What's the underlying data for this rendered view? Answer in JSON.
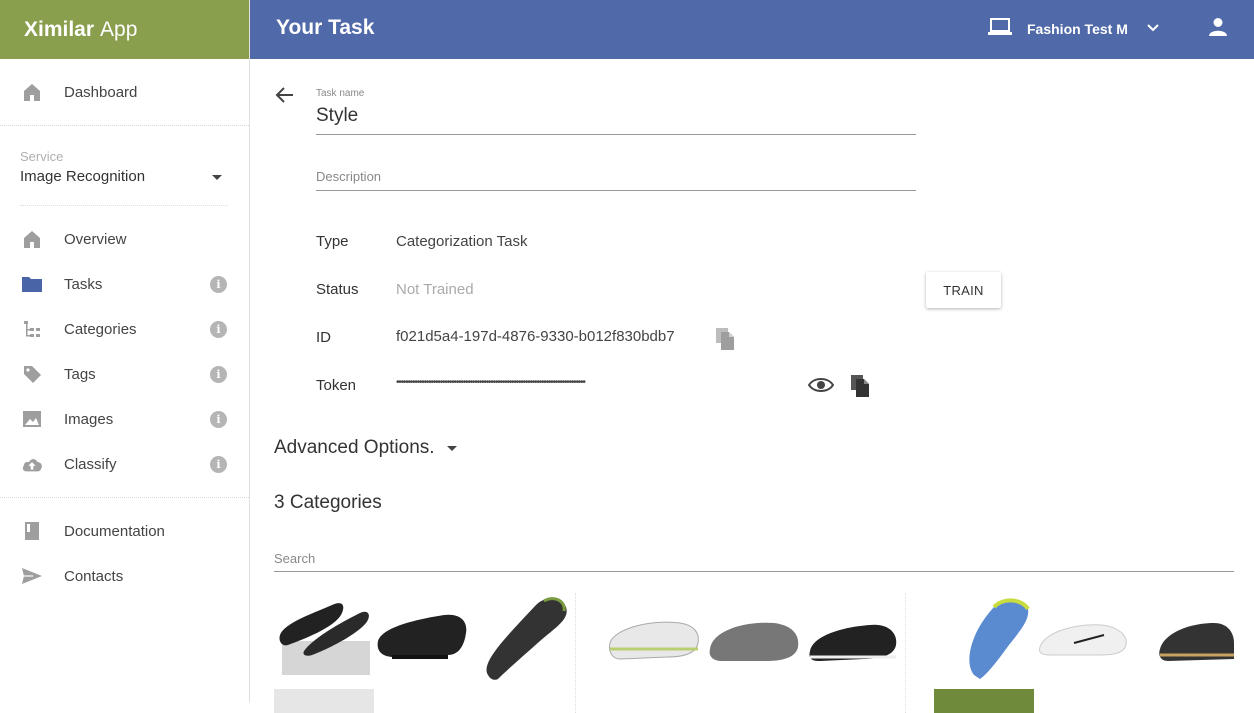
{
  "app": {
    "brand_bold": "Ximilar",
    "brand_light": "App"
  },
  "header": {
    "title": "Your Task",
    "account_name": "Fashion Test M"
  },
  "sidebar": {
    "dashboard": "Dashboard",
    "service_label": "Service",
    "service_value": "Image Recognition",
    "items": [
      {
        "label": "Overview"
      },
      {
        "label": "Tasks"
      },
      {
        "label": "Categories"
      },
      {
        "label": "Tags"
      },
      {
        "label": "Images"
      },
      {
        "label": "Classify"
      }
    ],
    "info_glyph": "i",
    "documentation": "Documentation",
    "contacts": "Contacts"
  },
  "task": {
    "name_label": "Task name",
    "name_value": "Style",
    "description_label": "Description",
    "type_label": "Type",
    "type_value": "Categorization Task",
    "status_label": "Status",
    "status_value": "Not Trained",
    "train_button": "TRAIN",
    "id_label": "ID",
    "id_value": "f021d5a4-197d-4876-9330-b012f830bdb7",
    "token_label": "Token",
    "token_value": "••••••••••••••••••••••••••••••••••••••••••••••••••••••••••••••••••••••••••••••••••"
  },
  "advanced_options": "Advanced Options.",
  "categories_title": "3 Categories",
  "search_placeholder": "Search",
  "colors": {
    "brand_green": "#8a9f4e",
    "header_blue": "#5069a8",
    "tasks_icon_blue": "#4a64a8"
  }
}
